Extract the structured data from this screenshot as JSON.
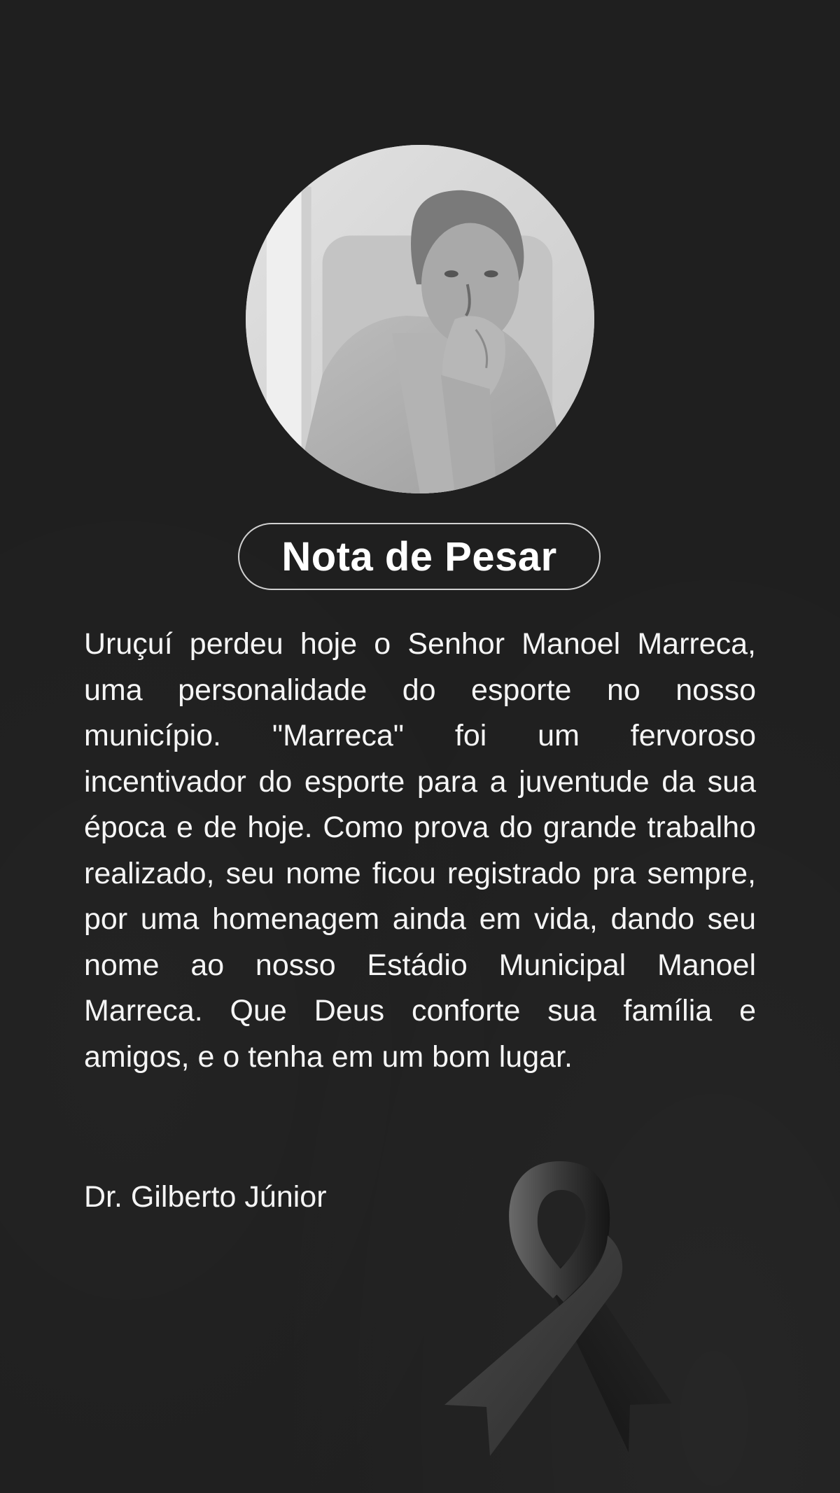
{
  "title": "Nota de Pesar",
  "message": "Uruçuí perdeu hoje o Senhor Manoel Marreca, uma personalidade do esporte no nosso município. \"Marreca\" foi um fervoroso incentivador do esporte para a juventude da sua época e de hoje. Como prova do grande trabalho realizado, seu nome ficou registrado pra sempre, por uma  homenagem ainda em vida, dando seu nome ao nosso Estádio Municipal Manoel Marreca. Que Deus conforte sua família e amigos, e o tenha em um bom lugar.",
  "signature": "Dr. Gilberto Júnior",
  "colors": {
    "background": "#1f1f1f",
    "text": "#f5f5f5",
    "border": "#d0d0d0",
    "ribbon": "#2e2e2e"
  },
  "icons": {
    "portrait": "portrait-photo",
    "ribbon": "mourning-ribbon-icon"
  }
}
